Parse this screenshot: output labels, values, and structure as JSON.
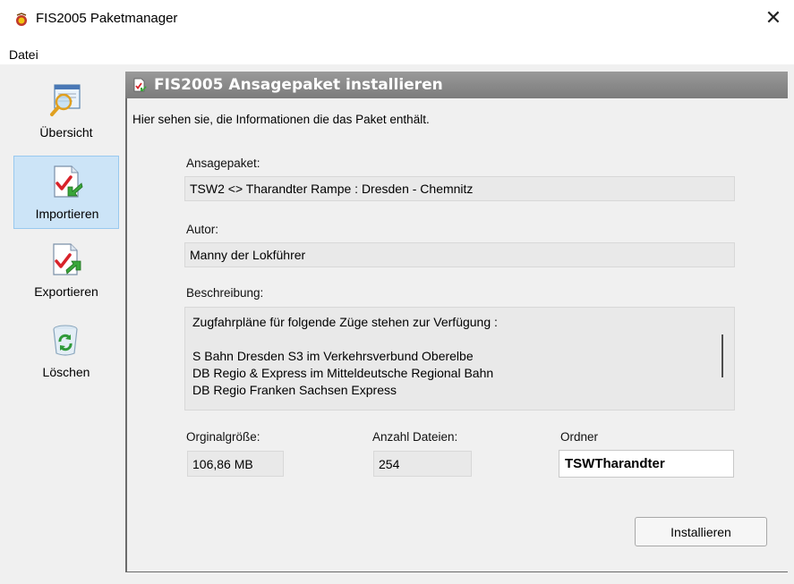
{
  "window": {
    "title": "FIS2005 Paketmanager",
    "close_glyph": "✕"
  },
  "menu": {
    "items": [
      {
        "label": "Datei"
      }
    ]
  },
  "sidebar": {
    "items": [
      {
        "label": "Übersicht",
        "icon": "overview-icon",
        "active": false
      },
      {
        "label": "Importieren",
        "icon": "import-icon",
        "active": true
      },
      {
        "label": "Exportieren",
        "icon": "export-icon",
        "active": false
      },
      {
        "label": "Löschen",
        "icon": "recycle-bin-icon",
        "active": false
      }
    ]
  },
  "panel": {
    "header": "FIS2005 Ansagepaket installieren",
    "intro": "Hier sehen sie, die Informationen die das Paket enthält.",
    "package_label": "Ansagepaket:",
    "package_value": "TSW2 <> Tharandter Rampe : Dresden - Chemnitz",
    "author_label": "Autor:",
    "author_value": "Manny der Lokführer",
    "description_label": "Beschreibung:",
    "description_lines": [
      "Zugfahrpläne für folgende Züge stehen zur Verfügung :",
      "",
      "S Bahn Dresden S3 im Verkehrsverbund Oberelbe",
      "DB Regio & Express im Mitteldeutsche Regional Bahn",
      "DB Regio Franken Sachsen Express"
    ],
    "size_label": "Orginalgröße:",
    "size_value": "106,86 MB",
    "count_label": "Anzahl Dateien:",
    "count_value": "254",
    "folder_label": "Ordner",
    "folder_value": "TSWTharandter",
    "install_button": "Installieren"
  },
  "colors": {
    "header_bg": "#8a8a8a",
    "active_item_bg": "#cce4f7",
    "field_bg": "#e9e9e9"
  }
}
